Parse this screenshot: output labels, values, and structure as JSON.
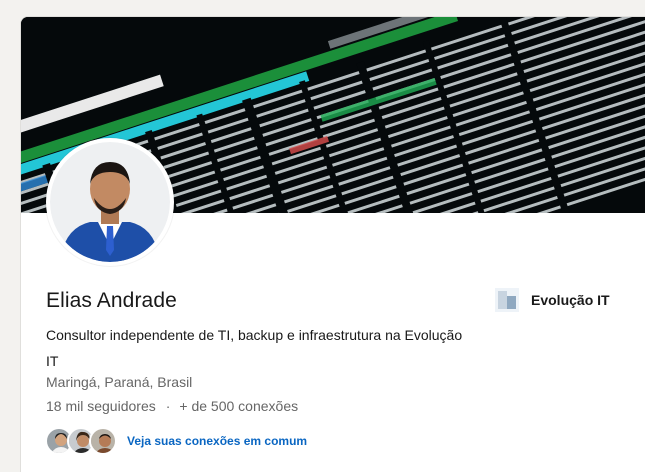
{
  "profile": {
    "name": "Elias Andrade",
    "headline": "Consultor independente de TI, backup e infraestrutura na Evolução IT",
    "location": "Maringá, Paraná, Brasil",
    "followers": "18 mil seguidores",
    "separator": "·",
    "connections": "+ de 500 conexões",
    "mutual_connections_label": "Veja suas conexões em comum"
  },
  "company": {
    "name": "Evolução IT"
  },
  "banner": {
    "description_icon": "terminal-htop-screenshot"
  },
  "colors": {
    "link": "#0a66c2",
    "text_primary": "#191919",
    "text_secondary": "#666666",
    "background": "#f3f2ef"
  }
}
